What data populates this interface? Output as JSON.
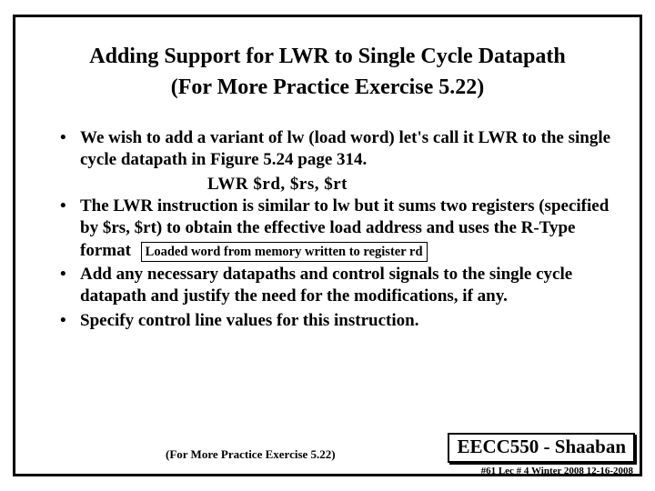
{
  "title": {
    "line1": "Adding Support for LWR to Single Cycle Datapath",
    "line2": "(For More Practice Exercise 5.22)"
  },
  "bullets": {
    "b1": "We wish to add  a variant of lw (load word)  let's call it LWR to the single cycle datapath in Figure 5.24 page 314.",
    "inst": "LWR   $rd, $rs,  $rt",
    "b2a": "The LWR instruction is similar to lw but it sums two registers (specified by $rs, $rt) to obtain the effective load address and uses the R-Type format",
    "b2_box": "Loaded word from memory written to register rd",
    "b3": "Add any necessary datapaths and control signals to the single cycle datapath and justify the need for the modifications, if any.",
    "b4": "Specify control line values for this instruction."
  },
  "footer": {
    "note": "(For More Practice Exercise 5.22)",
    "course": "EECC550 - Shaaban",
    "meta": "#61  Lec # 4   Winter 2008  12-16-2008"
  }
}
